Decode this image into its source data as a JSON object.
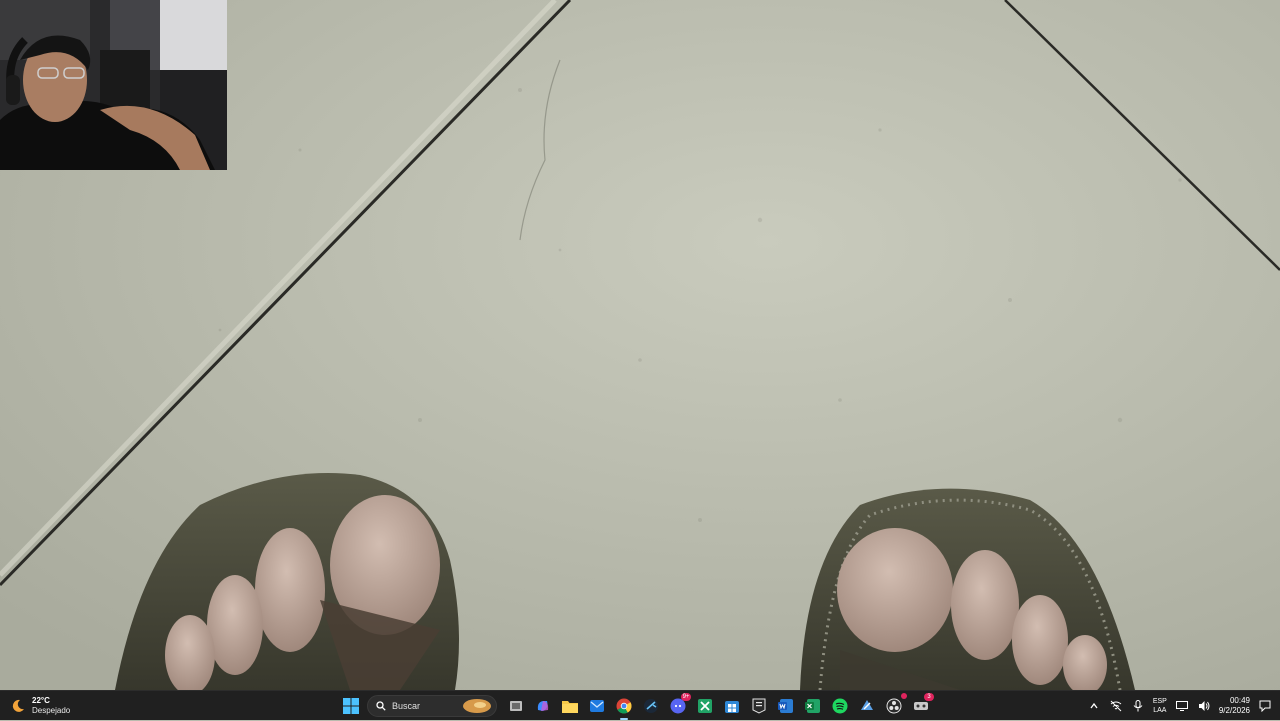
{
  "scene": {
    "floor_color": "#b9bbae",
    "groove_color": "#2a2a26",
    "sandal_color": "#4a4a3c",
    "skin_color": "#b79f93"
  },
  "taskbar": {
    "weather": {
      "temp": "22°C",
      "condition": "Despejado"
    },
    "search": {
      "placeholder": "Buscar"
    },
    "apps": [
      {
        "name": "windows-start",
        "icon": "windows-logo-icon"
      },
      {
        "name": "task-view",
        "icon": "task-view-icon"
      },
      {
        "name": "copilot",
        "icon": "copilot-icon"
      },
      {
        "name": "file-explorer",
        "icon": "folder-icon"
      },
      {
        "name": "outlook",
        "icon": "mail-icon"
      },
      {
        "name": "chrome",
        "icon": "chrome-icon",
        "active": true
      },
      {
        "name": "steam",
        "icon": "steam-icon"
      },
      {
        "name": "discord",
        "icon": "discord-icon",
        "badge": "9+"
      },
      {
        "name": "xbox",
        "icon": "xbox-icon"
      },
      {
        "name": "store",
        "icon": "store-icon"
      },
      {
        "name": "epic-games",
        "icon": "epic-games-icon"
      },
      {
        "name": "word",
        "icon": "word-icon"
      },
      {
        "name": "excel",
        "icon": "excel-icon"
      },
      {
        "name": "spotify",
        "icon": "spotify-icon"
      },
      {
        "name": "steam-2",
        "icon": "steam-icon"
      },
      {
        "name": "obs",
        "icon": "obs-icon"
      },
      {
        "name": "recorder",
        "icon": "recorder-icon",
        "badge": "3"
      }
    ],
    "tray": {
      "language_line1": "ESP",
      "language_line2": "LAA",
      "time": "00:49",
      "date": "9/2/2026"
    }
  }
}
